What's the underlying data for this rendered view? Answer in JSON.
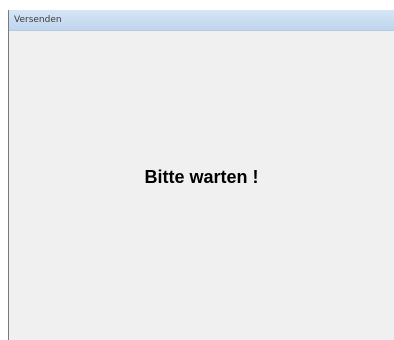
{
  "window": {
    "title": "Versenden"
  },
  "content": {
    "message": "Bitte warten !"
  }
}
